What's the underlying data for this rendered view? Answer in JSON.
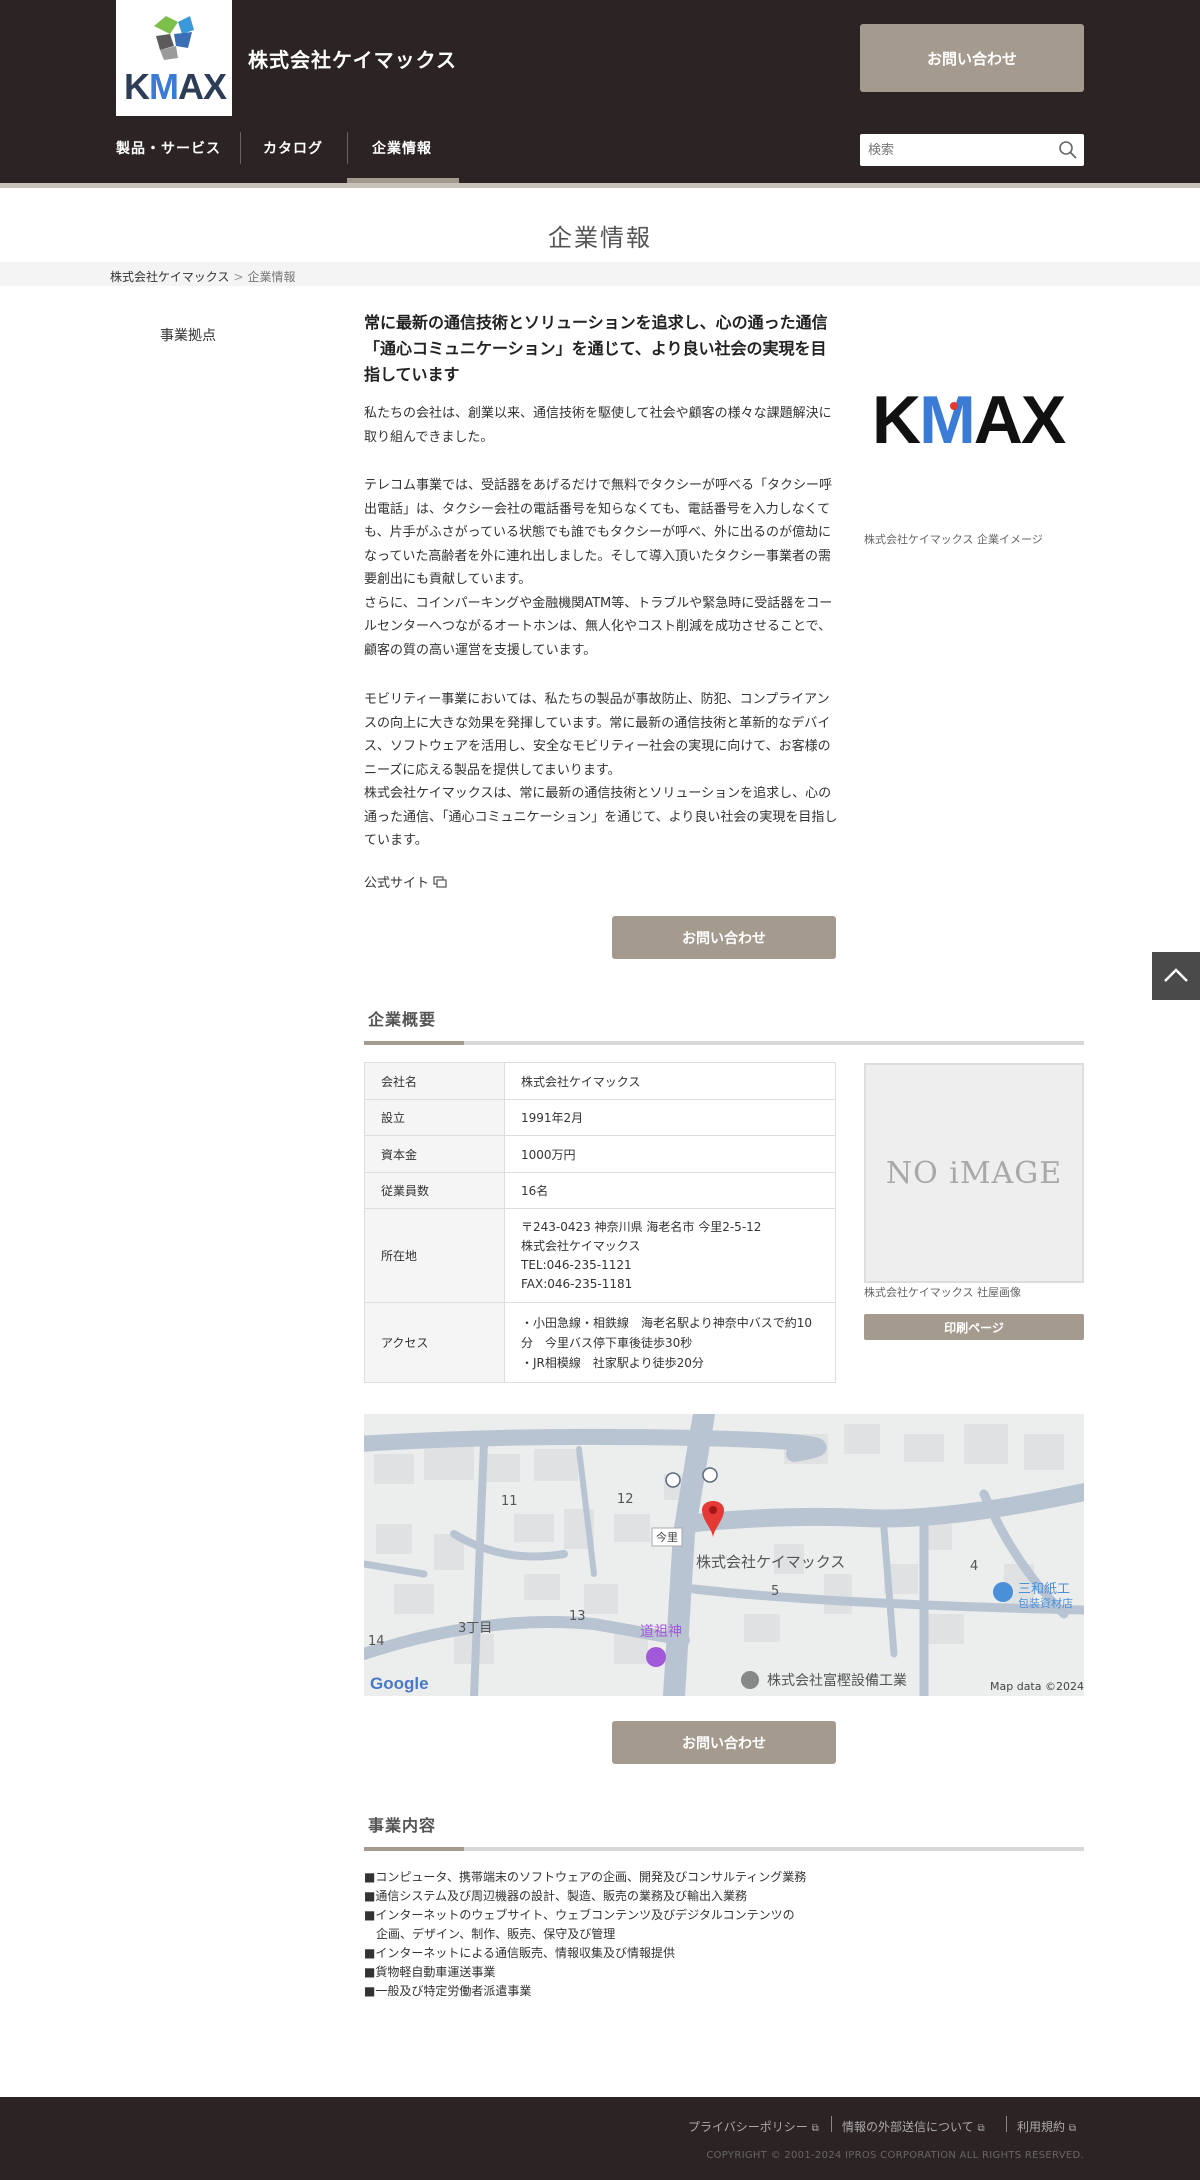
{
  "header": {
    "logo_text": "KMAX",
    "company_name": "株式会社ケイマックス",
    "contact_label": "お問い合わせ",
    "nav": [
      "製品・サービス",
      "カタログ",
      "企業情報"
    ],
    "search_placeholder": "検索"
  },
  "page_title": "企業情報",
  "breadcrumb": {
    "home": "株式会社ケイマックス",
    "separator": ">",
    "current": "企業情報"
  },
  "sidebar": {
    "link": "事業拠点"
  },
  "main": {
    "headline": "常に最新の通信技術とソリューションを追求し、心の通った通信「通心コミュニケーション」を通じて、より良い社会の実現を目指しています",
    "paragraphs": [
      "私たちの会社は、創業以来、通信技術を駆使して社会や顧客の様々な課題解決に取り組んできました。",
      "テレコム事業では、受話器をあげるだけで無料でタクシーが呼べる「タクシー呼出電話」は、タクシー会社の電話番号を知らなくても、電話番号を入力しなくても、片手がふさがっている状態でも誰でもタクシーが呼べ、外に出るのが億劫になっていた高齢者を外に連れ出しました。そして導入頂いたタクシー事業者の需要創出にも貢献しています。\nさらに、コインパーキングや金融機関ATM等、トラブルや緊急時に受話器をコールセンターへつながるオートホンは、無人化やコスト削減を成功させることで、顧客の質の高い運営を支援しています。",
      "モビリティー事業においては、私たちの製品が事故防止、防犯、コンプライアンスの向上に大きな効果を発揮しています。常に最新の通信技術と革新的なデバイス、ソフトウェアを活用し、安全なモビリティー社会の実現に向けて、お客様のニーズに応える製品を提供してまいります。\n株式会社ケイマックスは、常に最新の通信技術とソリューションを追求し、心の通った通信、「通心コミュニケーション」を通じて、より良い社会の実現を目指しています。"
    ],
    "official_site": "公式サイト",
    "contact_label": "お問い合わせ",
    "image_logo": "KMAX",
    "image_caption": "株式会社ケイマックス 企業イメージ"
  },
  "overview": {
    "title": "企業概要",
    "rows": [
      {
        "label": "会社名",
        "value": "株式会社ケイマックス"
      },
      {
        "label": "設立",
        "value": "1991年2月"
      },
      {
        "label": "資本金",
        "value": "1000万円"
      },
      {
        "label": "従業員数",
        "value": "16名"
      },
      {
        "label": "所在地",
        "value": "〒243-0423 神奈川県 海老名市 今里2-5-12\n株式会社ケイマックス\nTEL:046-235-1121\nFAX:046-235-1181"
      },
      {
        "label": "アクセス",
        "value": "・小田急線・相鉄線　海老名駅より神奈中バスで約10分　今里バス停下車後徒歩30秒\n・JR相模線　社家駅より徒歩20分"
      }
    ],
    "noimage": "NO iMAGE",
    "image_caption": "株式会社ケイマックス 社屋画像",
    "print_label": "印刷ページ"
  },
  "map": {
    "labels": {
      "n11": "11",
      "n12": "12",
      "n13": "13",
      "n14": "14",
      "n4": "4",
      "n5": "5",
      "chome3": "3丁目",
      "imazato": "今里",
      "pin": "株式会社ケイマックス",
      "dosojin": "道祖神",
      "sanwa1": "三和紙工",
      "sanwa2": "包装資材店",
      "tomi": "株式会社富樫設備工業",
      "google": "Google",
      "mapdata": "Map data ©2024"
    },
    "colors": {
      "pin": "#e53935",
      "poi_purple": "#a259d9",
      "poi_blue": "#4a90d9"
    }
  },
  "contact2_label": "お問い合わせ",
  "business": {
    "title": "事業内容",
    "items": [
      "■コンピュータ、携帯端末のソフトウェアの企画、開発及びコンサルティング業務",
      "■通信システム及び周辺機器の設計、製造、販売の業務及び輸出入業務",
      "■インターネットのウェブサイト、ウェブコンテンツ及びデジタルコンテンツの",
      "　企画、デザイン、制作、販売、保守及び管理",
      "■インターネットによる通信販売、情報収集及び情報提供",
      "■貨物軽自動車運送事業",
      "■一般及び特定労働者派遣事業"
    ]
  },
  "footer": {
    "links": [
      "プライバシーポリシー",
      "情報の外部送信について",
      "利用規約"
    ],
    "copyright": "COPYRIGHT © 2001-2024 IPROS CORPORATION ALL RIGHTS RESERVED."
  },
  "colors": {
    "header_bg": "#2b2324",
    "accent": "#a59a8e",
    "kmax_blue": "#3a7bd5"
  }
}
